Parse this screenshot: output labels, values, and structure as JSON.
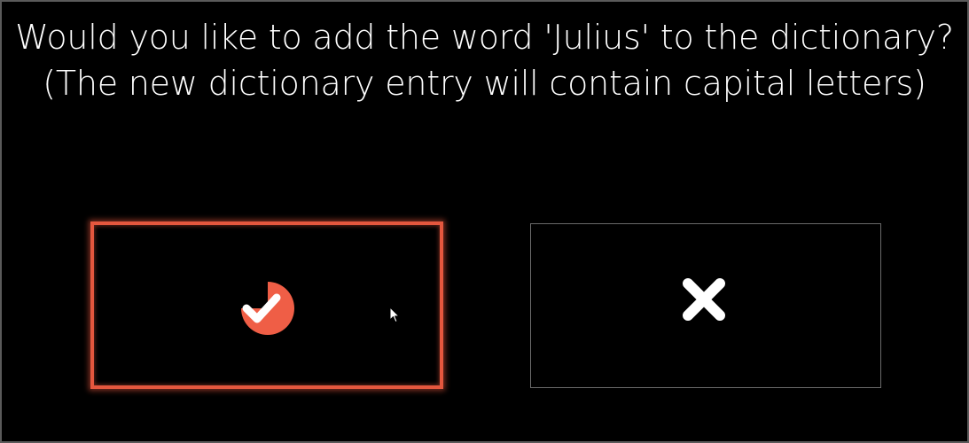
{
  "dialog": {
    "message_line1": "Would you like to add the word 'Julius' to the dictionary?",
    "message_line2": "(The new dictionary entry will contain capital letters)"
  },
  "buttons": {
    "confirm": {
      "icon": "check-icon",
      "state": "focused",
      "accent_color": "#e5573e"
    },
    "cancel": {
      "icon": "close-icon",
      "color": "#ffffff"
    }
  },
  "colors": {
    "background": "#000000",
    "text": "#ffffff",
    "accent": "#e5573e",
    "neutral_border": "#6a6a6a"
  }
}
